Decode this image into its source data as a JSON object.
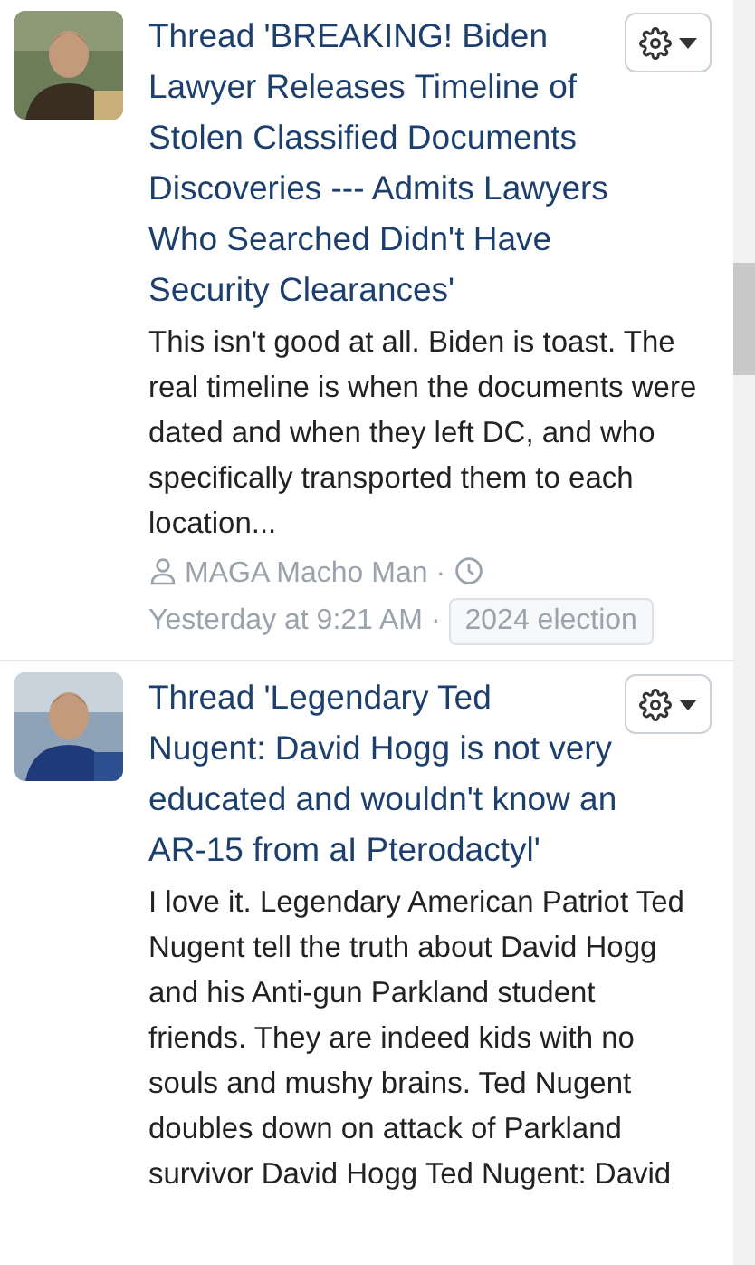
{
  "posts": [
    {
      "title": "Thread 'BREAKING! Biden Lawyer Releases Timeline of Stolen Classified Documents Discoveries --- Admits Lawyers Who Searched Didn't Have Security Clearances'",
      "snippet": "This isn't good at all. Biden is toast. The real timeline is when the documents were dated and when they left DC, and who specifically transported them to each location...",
      "meta": {
        "author": "MAGA Macho Man",
        "separator_1": "·",
        "time": "Yesterday at 9:21 AM",
        "separator_2": "·",
        "tag": "2024 election"
      }
    },
    {
      "title": "Thread 'Legendary Ted Nugent: David Hogg is not very educated and wouldn't know an AR-15 from aI Pterodactyl'",
      "snippet": "I love it. Legendary American Patriot Ted Nugent tell the truth about David Hogg and his Anti-gun Parkland student friends. They are indeed kids with no souls and mushy brains. Ted Nugent doubles down on attack of Parkland survivor David Hogg Ted Nugent: David"
    }
  ]
}
